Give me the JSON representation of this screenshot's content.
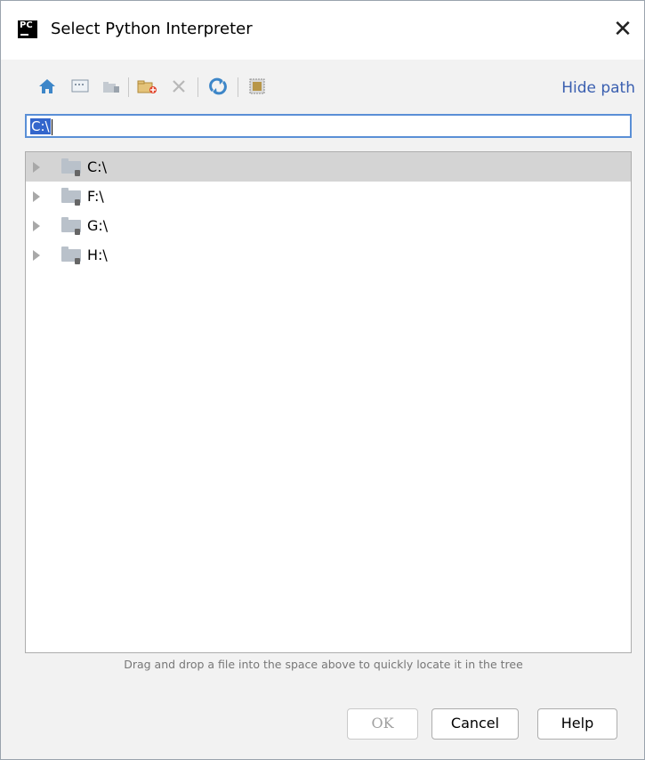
{
  "window": {
    "title": "Select Python Interpreter",
    "app_icon_text": "PC",
    "close_glyph": "✕"
  },
  "toolbar": {
    "icons": [
      "home-icon",
      "desktop-icon",
      "project-folder-icon",
      "new-folder-icon",
      "delete-icon",
      "refresh-icon",
      "show-hidden-icon"
    ],
    "hide_path_label": "Hide path"
  },
  "path_field": {
    "value": "C:\\"
  },
  "tree": {
    "items": [
      {
        "label": "C:\\",
        "selected": true
      },
      {
        "label": "F:\\",
        "selected": false
      },
      {
        "label": "G:\\",
        "selected": false
      },
      {
        "label": "H:\\",
        "selected": false
      }
    ]
  },
  "hint": "Drag and drop a file into the space above to quickly locate it in the tree",
  "buttons": {
    "ok": "OK",
    "cancel": "Cancel",
    "help": "Help"
  },
  "colors": {
    "link": "#3a5fb0",
    "selection": "#3366cc",
    "focus_border": "#5a8fd6",
    "selected_row": "#d4d4d4"
  }
}
